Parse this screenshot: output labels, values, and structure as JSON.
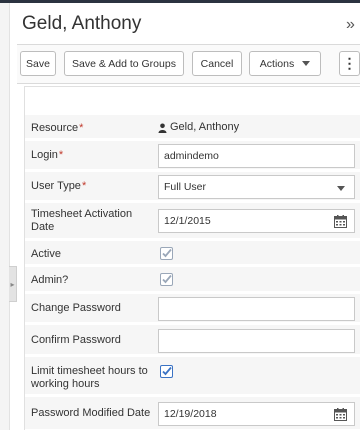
{
  "header": {
    "title": "Geld, Anthony",
    "expand_icon": "»"
  },
  "toolbar": {
    "save_label": "Save",
    "save_add_groups_label": "Save & Add to Groups",
    "cancel_label": "Cancel",
    "actions_label": "Actions",
    "more_icon": "⋮"
  },
  "form": {
    "resource": {
      "label": "Resource",
      "value": "Geld, Anthony",
      "required_mark": "*"
    },
    "login": {
      "label": "Login",
      "value": "admindemo",
      "required_mark": "*"
    },
    "user_type": {
      "label": "User Type",
      "value": "Full User",
      "required_mark": "*"
    },
    "timesheet_activation": {
      "label": "Timesheet Activation Date",
      "value": "12/1/2015"
    },
    "active": {
      "label": "Active",
      "checked": true
    },
    "admin": {
      "label": "Admin?",
      "checked": true
    },
    "change_password": {
      "label": "Change Password",
      "value": ""
    },
    "confirm_password": {
      "label": "Confirm Password",
      "value": ""
    },
    "limit_timesheet": {
      "label": "Limit timesheet hours to working hours",
      "checked": true
    },
    "password_modified": {
      "label": "Password Modified Date",
      "value": "12/19/2018"
    }
  },
  "colors": {
    "checkbox_checked": "#3b73c4",
    "checkbox_disabled": "#9aa7b8",
    "required": "#c0392b"
  }
}
